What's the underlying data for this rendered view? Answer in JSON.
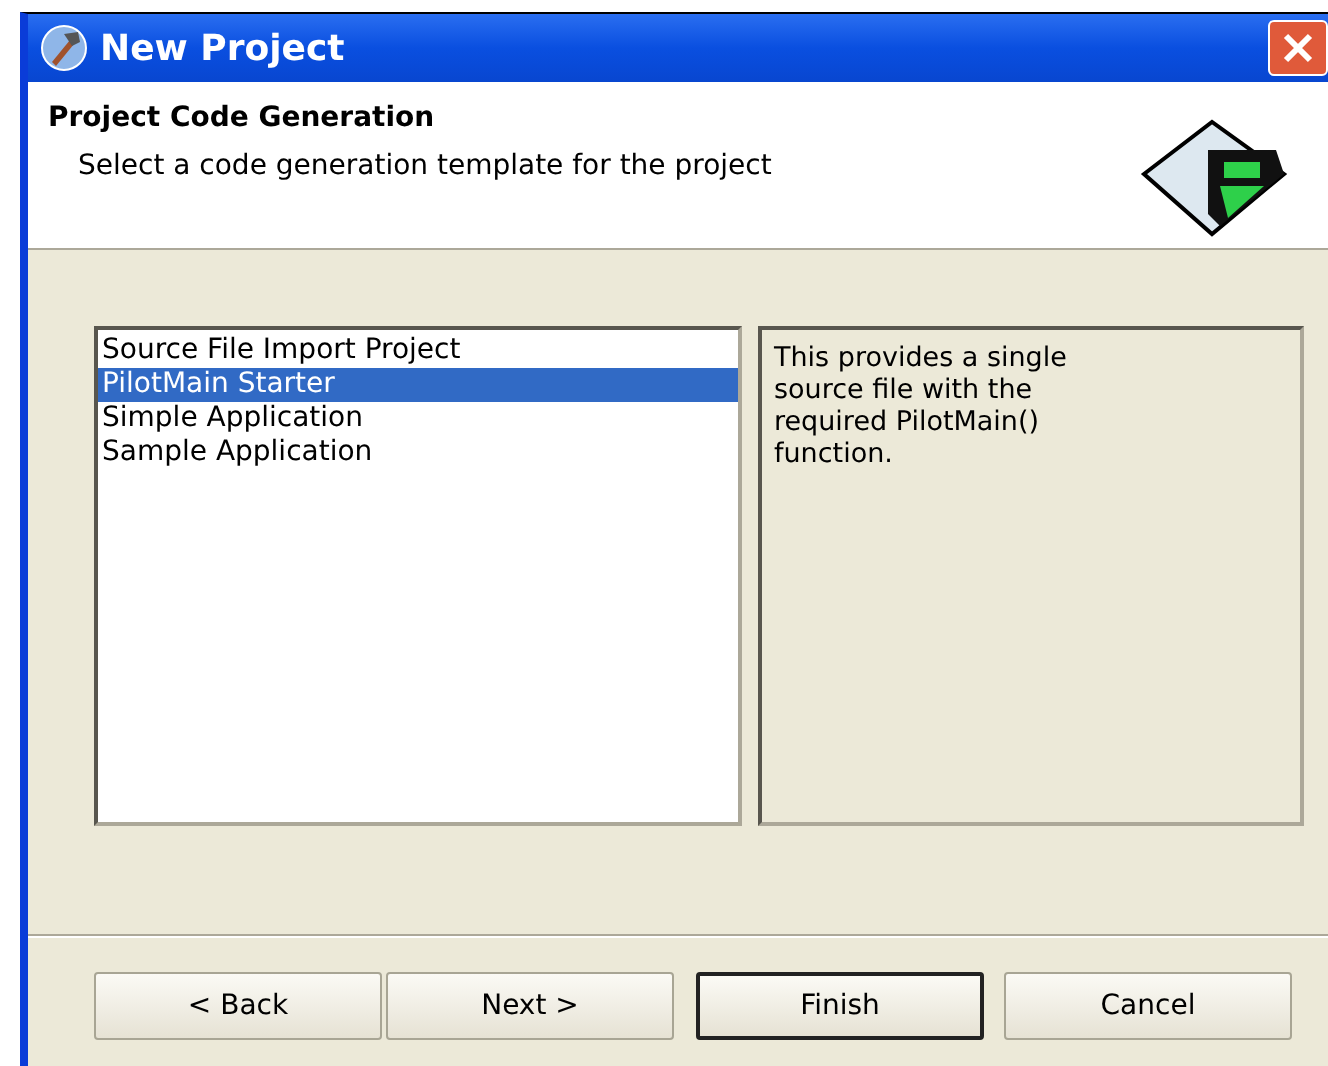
{
  "window": {
    "title": "New Project"
  },
  "header": {
    "title": "Project Code Generation",
    "subtitle": "Select a code generation template for the project"
  },
  "templates": [
    {
      "label": "Source File Import Project",
      "selected": false
    },
    {
      "label": "PilotMain Starter",
      "selected": true
    },
    {
      "label": "Simple Application",
      "selected": false
    },
    {
      "label": "Sample Application",
      "selected": false
    }
  ],
  "description": "This provides a single source file with the required PilotMain() function.",
  "buttons": [
    {
      "label": "< Back",
      "kind": "normal"
    },
    {
      "label": "Next >",
      "kind": "normal"
    },
    {
      "label": "Finish",
      "kind": "default"
    },
    {
      "label": "Cancel",
      "kind": "normal"
    }
  ]
}
